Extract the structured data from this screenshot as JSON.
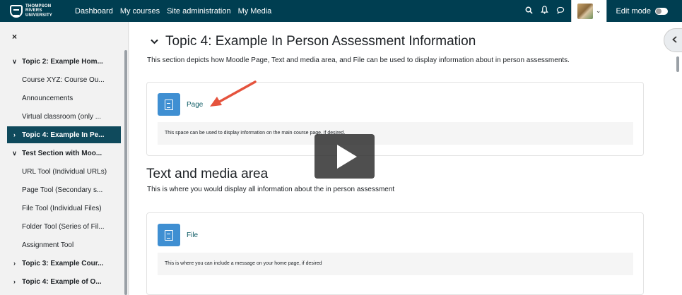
{
  "logo": {
    "line1": "THOMPSON",
    "line2": "RIVERS",
    "line3": "UNIVERSITY"
  },
  "nav": {
    "links": [
      "Dashboard",
      "My courses",
      "Site administration",
      "My Media"
    ],
    "edit_mode_label": "Edit mode",
    "icons": [
      "search-icon",
      "bell-icon",
      "chat-icon"
    ]
  },
  "drawer": {
    "close": "×",
    "items": [
      {
        "label": "Topic 2: Example Hom...",
        "type": "section",
        "chevron": "∨"
      },
      {
        "label": "Course XYZ: Course Ou...",
        "type": "child"
      },
      {
        "label": "Announcements",
        "type": "child"
      },
      {
        "label": "Virtual classroom (only ...",
        "type": "child"
      },
      {
        "label": "Topic 4: Example In Pe...",
        "type": "section-active",
        "chevron": "›"
      },
      {
        "label": "Test Section with Moo...",
        "type": "section",
        "chevron": "∨"
      },
      {
        "label": "URL Tool (Individual URLs)",
        "type": "child"
      },
      {
        "label": "Page Tool (Secondary s...",
        "type": "child"
      },
      {
        "label": "File Tool (Individual Files)",
        "type": "child"
      },
      {
        "label": "Folder Tool (Series of Fil...",
        "type": "child"
      },
      {
        "label": "Assignment Tool",
        "type": "child"
      },
      {
        "label": "Topic 3: Example Cour...",
        "type": "section",
        "chevron": "›"
      },
      {
        "label": "Topic 4: Example of O...",
        "type": "section",
        "chevron": "›"
      }
    ]
  },
  "main": {
    "topic_title": "Topic 4: Example In Person Assessment Information",
    "topic_desc": "This section depicts how Moodle Page, Text and media area, and File can be used to display information about in person assessments.",
    "page_activity": {
      "label": "Page",
      "note": "This space can be used to display information on the main course page, if desired."
    },
    "text_media_title": "Text and media area",
    "text_media_desc": "This is where you would display all information about the in person assessment",
    "file_activity": {
      "label": "File",
      "note": "This is where you can include a message on your home page, if desired"
    }
  },
  "colors": {
    "navbar": "#003e51",
    "active": "#0f4a5c",
    "activity_icon": "#3f8fd2",
    "arrow": "#e5533d"
  }
}
